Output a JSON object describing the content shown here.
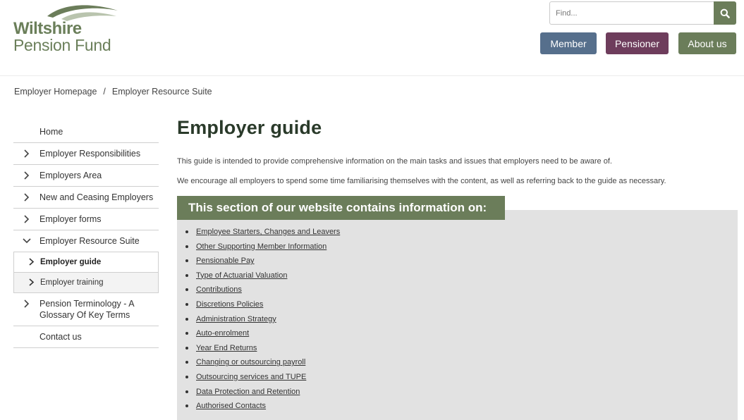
{
  "header": {
    "logo": {
      "line1": "Wiltshire",
      "line2": "Pension Fund"
    },
    "search": {
      "placeholder": "Find...",
      "icon": "search-icon"
    },
    "nav": {
      "member": "Member",
      "pensioner": "Pensioner",
      "about": "About us"
    },
    "colors": {
      "member": "#566f8c",
      "pensioner": "#6e3d5c",
      "about": "#6b7d5a",
      "brand": "#6b7d5a"
    }
  },
  "breadcrumb": {
    "items": [
      "Employer Homepage",
      "Employer Resource Suite"
    ],
    "separator": "/"
  },
  "sidebar": {
    "items": [
      {
        "label": "Home",
        "icon": ""
      },
      {
        "label": "Employer Responsibilities",
        "icon": "chevron-right-icon"
      },
      {
        "label": "Employers Area",
        "icon": "chevron-right-icon"
      },
      {
        "label": "New and Ceasing Employers",
        "icon": "chevron-right-icon"
      },
      {
        "label": "Employer forms",
        "icon": "chevron-right-icon"
      },
      {
        "label": "Employer Resource Suite",
        "icon": "chevron-down-icon"
      },
      {
        "label": "Pension Terminology - A Glossary Of Key Terms",
        "icon": "chevron-right-icon"
      },
      {
        "label": "Contact us",
        "icon": ""
      }
    ],
    "subitems": [
      {
        "label": "Employer guide",
        "active": true
      },
      {
        "label": "Employer training",
        "active": false
      }
    ]
  },
  "main": {
    "title": "Employer guide",
    "intro1": "This guide is intended to provide comprehensive information on the main tasks and issues that employers need to be aware of.",
    "intro2": "We encourage all employers to spend some time familiarising themselves with the content, as well as referring back to the guide as necessary.",
    "panel_heading": "This section of our website contains information on:",
    "links": [
      "Employee Starters, Changes and Leavers",
      "Other Supporting Member Information",
      "Pensionable Pay",
      "Type of Actuarial Valuation",
      "Contributions",
      "Discretions Policies",
      "Administration Strategy",
      "Auto-enrolment",
      "Year End Returns",
      "Changing or outsourcing payroll",
      "Outsourcing services and TUPE",
      "Data Protection and Retention",
      "Authorised Contacts"
    ]
  }
}
